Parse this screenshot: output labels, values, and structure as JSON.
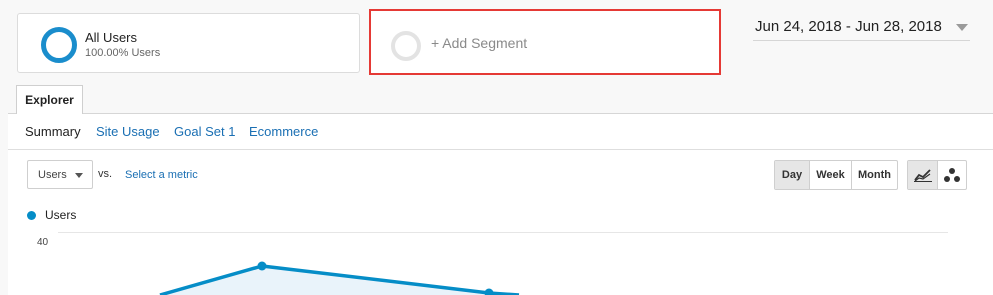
{
  "segments": {
    "active": {
      "name": "All Users",
      "detail": "100.00% Users"
    },
    "add_label": "+ Add Segment"
  },
  "date_range": {
    "label": "Jun 24, 2018 - Jun 28, 2018"
  },
  "tabs": {
    "explorer": "Explorer"
  },
  "subtabs": [
    {
      "label": "Summary",
      "active": true
    },
    {
      "label": "Site Usage",
      "active": false
    },
    {
      "label": "Goal Set 1",
      "active": false
    },
    {
      "label": "Ecommerce",
      "active": false
    }
  ],
  "metric": {
    "selected": "Users",
    "vs_label": "vs.",
    "compare_link": "Select a metric"
  },
  "period": {
    "options": [
      "Day",
      "Week",
      "Month"
    ],
    "selected": "Day"
  },
  "chart_type": {
    "options": [
      "line-chart-icon",
      "motion-chart-icon"
    ],
    "selected": "line-chart-icon"
  },
  "chart_data": {
    "type": "area",
    "series": [
      {
        "name": "Users",
        "color": "#058dc7"
      }
    ],
    "y_ticks": [
      40
    ],
    "y_max_visible": 40
  },
  "colors": {
    "accent": "#058dc7",
    "highlight_border": "#e53935",
    "link": "#1a6fb3"
  }
}
